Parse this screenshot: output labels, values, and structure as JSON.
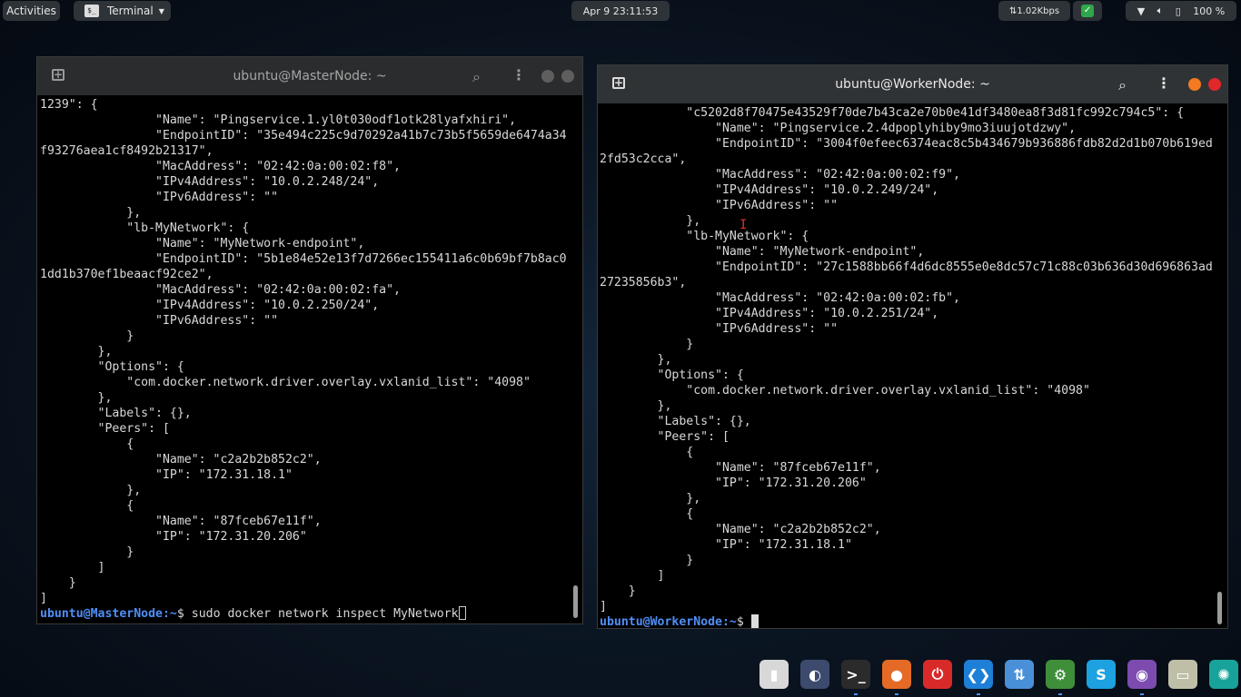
{
  "topbar": {
    "activities": "Activities",
    "app_menu": "Terminal",
    "clock": "Apr 9  23:11:53",
    "net_speed": "⇅1.02Kbps",
    "battery_pct": "100 %",
    "icons": [
      "shield-ok-icon",
      "wifi-icon",
      "volume-icon",
      "battery-icon"
    ]
  },
  "master": {
    "title": "ubuntu@MasterNode: ~",
    "lines": [
      "1239\": {",
      "                \"Name\": \"Pingservice.1.yl0t030odf1otk28lyafxhiri\",",
      "                \"EndpointID\": \"35e494c225c9d70292a41b7c73b5f5659de6474a34",
      "f93276aea1cf8492b21317\",",
      "                \"MacAddress\": \"02:42:0a:00:02:f8\",",
      "                \"IPv4Address\": \"10.0.2.248/24\",",
      "                \"IPv6Address\": \"\"",
      "            },",
      "            \"lb-MyNetwork\": {",
      "                \"Name\": \"MyNetwork-endpoint\",",
      "                \"EndpointID\": \"5b1e84e52e13f7d7266ec155411a6c0b69bf7b8ac0",
      "1dd1b370ef1beaacf92ce2\",",
      "                \"MacAddress\": \"02:42:0a:00:02:fa\",",
      "                \"IPv4Address\": \"10.0.2.250/24\",",
      "                \"IPv6Address\": \"\"",
      "            }",
      "        },",
      "        \"Options\": {",
      "            \"com.docker.network.driver.overlay.vxlanid_list\": \"4098\"",
      "        },",
      "        \"Labels\": {},",
      "        \"Peers\": [",
      "            {",
      "                \"Name\": \"c2a2b2b852c2\",",
      "                \"IP\": \"172.31.18.1\"",
      "            },",
      "            {",
      "                \"Name\": \"87fceb67e11f\",",
      "                \"IP\": \"172.31.20.206\"",
      "            }",
      "        ]",
      "    }",
      "]"
    ],
    "prompt_user": "ubuntu@MasterNode",
    "prompt_path": ":~",
    "prompt_symbol": "$ ",
    "command": "sudo docker network inspect MyNetwork"
  },
  "worker": {
    "title": "ubuntu@WorkerNode: ~",
    "lines": [
      "            \"c5202d8f70475e43529f70de7b43ca2e70b0e41df3480ea8f3d81fc992c794c5\": {",
      "                \"Name\": \"Pingservice.2.4dpoplyhiby9mo3iuujotdzwy\",",
      "                \"EndpointID\": \"3004f0efeec6374eac8c5b434679b936886fdb82d2d1b070b619ed",
      "2fd53c2cca\",",
      "                \"MacAddress\": \"02:42:0a:00:02:f9\",",
      "                \"IPv4Address\": \"10.0.2.249/24\",",
      "                \"IPv6Address\": \"\"",
      "            },",
      "            \"lb-MyNetwork\": {",
      "                \"Name\": \"MyNetwork-endpoint\",",
      "                \"EndpointID\": \"27c1588bb66f4d6dc8555e0e8dc57c71c88c03b636d30d696863ad",
      "27235856b3\",",
      "                \"MacAddress\": \"02:42:0a:00:02:fb\",",
      "                \"IPv4Address\": \"10.0.2.251/24\",",
      "                \"IPv6Address\": \"\"",
      "            }",
      "        },",
      "        \"Options\": {",
      "            \"com.docker.network.driver.overlay.vxlanid_list\": \"4098\"",
      "        },",
      "        \"Labels\": {},",
      "        \"Peers\": [",
      "            {",
      "                \"Name\": \"87fceb67e11f\",",
      "                \"IP\": \"172.31.20.206\"",
      "            },",
      "            {",
      "                \"Name\": \"c2a2b2b852c2\",",
      "                \"IP\": \"172.31.18.1\"",
      "            }",
      "        ]",
      "    }",
      "]"
    ],
    "prompt_user": "ubuntu@WorkerNode",
    "prompt_path": ":~",
    "prompt_symbol": "$ ",
    "command": ""
  },
  "dock": {
    "items": [
      {
        "name": "archive-manager-icon",
        "color": "#d8d8d8",
        "glyph": "▮"
      },
      {
        "name": "eclipse-icon",
        "color": "#3c4a6e",
        "glyph": "◐"
      },
      {
        "name": "terminal-icon",
        "color": "#2b2b2b",
        "glyph": ">_"
      },
      {
        "name": "firefox-icon",
        "color": "#e56a26",
        "glyph": "●"
      },
      {
        "name": "power-icon",
        "color": "#d92a2a",
        "glyph": "⏻"
      },
      {
        "name": "vscode-icon",
        "color": "#1e7fd6",
        "glyph": "❮❯"
      },
      {
        "name": "network-manager-icon",
        "color": "#4a90d9",
        "glyph": "⇅"
      },
      {
        "name": "gimp-settings-icon",
        "color": "#3f8f3a",
        "glyph": "⚙"
      },
      {
        "name": "skype-icon",
        "color": "#1da1e0",
        "glyph": "S"
      },
      {
        "name": "tor-browser-icon",
        "color": "#7d4bb0",
        "glyph": "◉"
      },
      {
        "name": "files-icon",
        "color": "#bfbfa8",
        "glyph": "▭"
      },
      {
        "name": "teal-app-icon",
        "color": "#18a39a",
        "glyph": "✺"
      }
    ]
  }
}
